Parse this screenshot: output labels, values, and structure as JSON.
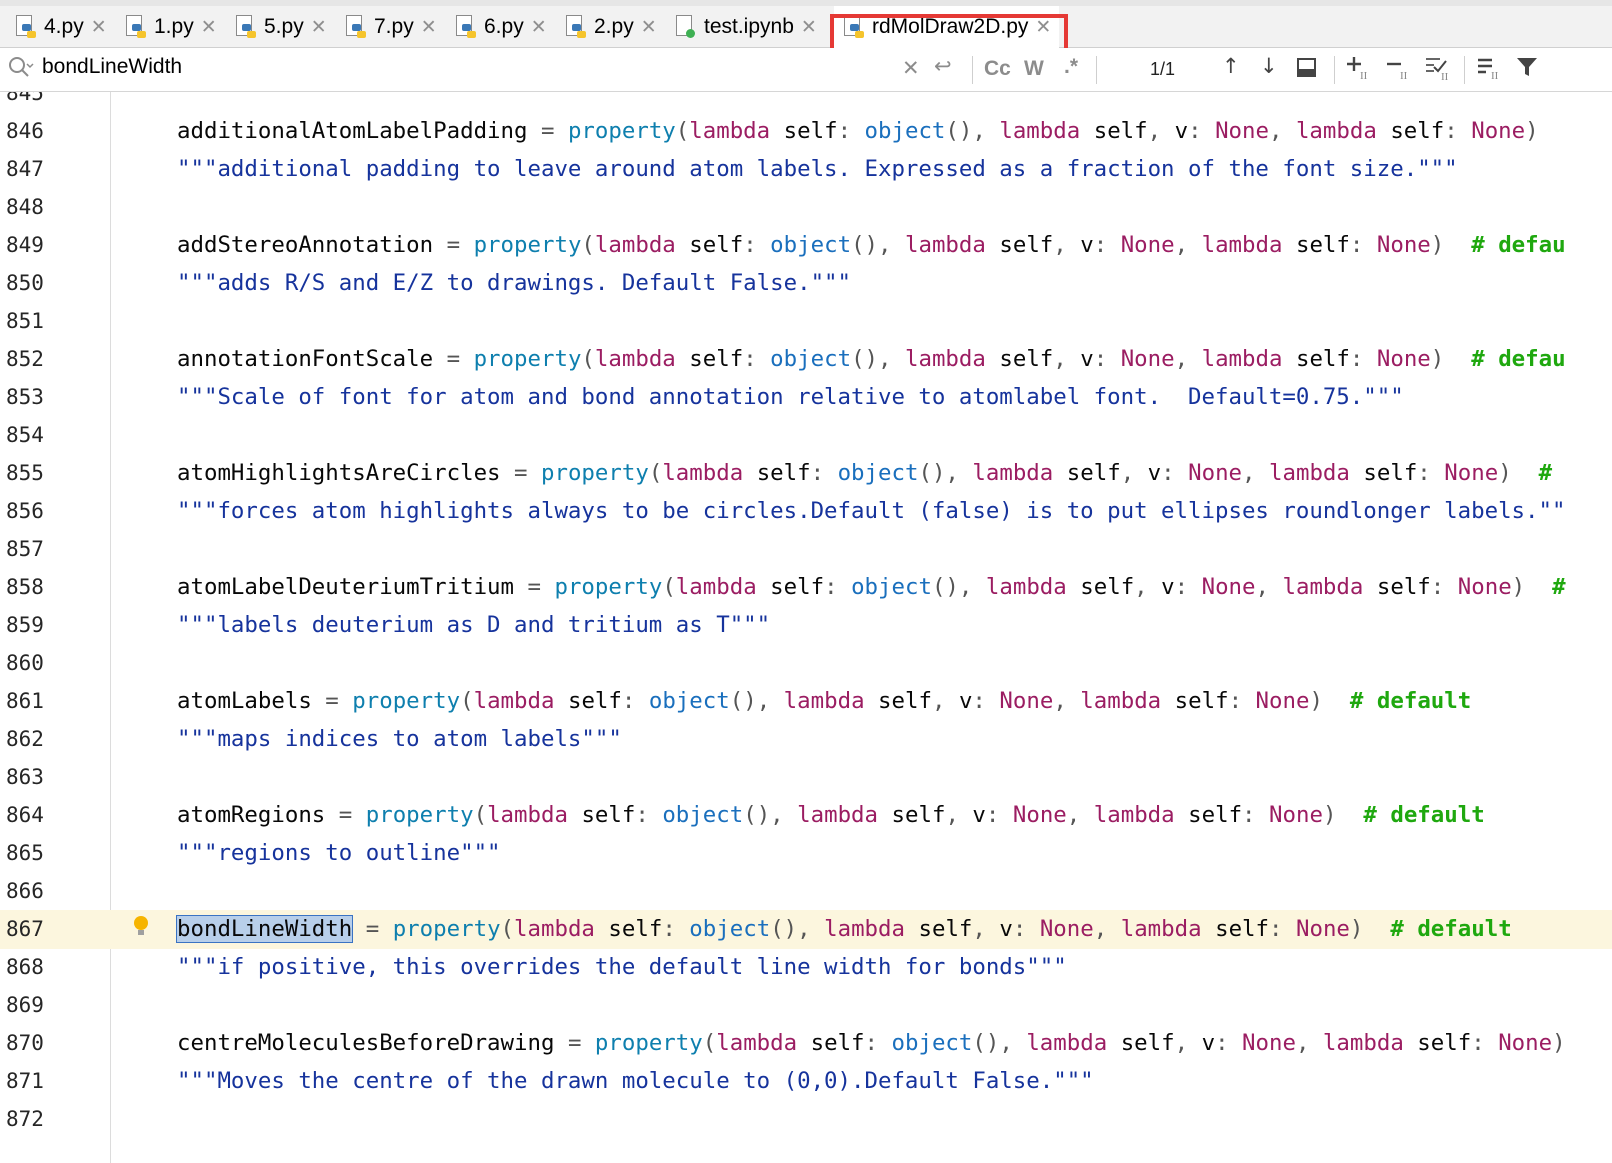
{
  "tabs": [
    {
      "label": "4.py",
      "kind": "py"
    },
    {
      "label": "1.py",
      "kind": "py"
    },
    {
      "label": "5.py",
      "kind": "py"
    },
    {
      "label": "7.py",
      "kind": "py"
    },
    {
      "label": "6.py",
      "kind": "py"
    },
    {
      "label": "2.py",
      "kind": "py"
    },
    {
      "label": "test.ipynb",
      "kind": "ipynb"
    },
    {
      "label": "rdMolDraw2D.py",
      "kind": "py",
      "active": true
    }
  ],
  "search": {
    "value": "bondLineWidth",
    "match_count": "1/1",
    "case_label": "Cc",
    "words_label": "W",
    "regex_label": ".*"
  },
  "editor": {
    "partial_line_number": "845",
    "current_line": "867",
    "lines": [
      {
        "n": "846",
        "code": [
          [
            "additionalAtomLabelPadding ",
            ""
          ],
          [
            "= ",
            "punc"
          ],
          [
            "property",
            "fn"
          ],
          [
            "(",
            "punc"
          ],
          [
            "lambda ",
            "kw"
          ],
          [
            "self",
            ""
          ],
          [
            ": ",
            "punc"
          ],
          [
            "object",
            "obj"
          ],
          [
            "(), ",
            "punc"
          ],
          [
            "lambda ",
            "kw"
          ],
          [
            "self",
            ""
          ],
          [
            ", ",
            "punc"
          ],
          [
            "v",
            ""
          ],
          [
            ": ",
            "punc"
          ],
          [
            "None",
            "none"
          ],
          [
            ", ",
            "punc"
          ],
          [
            "lambda ",
            "kw"
          ],
          [
            "self",
            ""
          ],
          [
            ": ",
            "punc"
          ],
          [
            "None",
            "none"
          ],
          [
            ")",
            "punc"
          ]
        ]
      },
      {
        "n": "847",
        "code": [
          [
            "\"\"\"additional padding to leave around atom labels. Expressed as a fraction of the font size.\"\"\"",
            "str"
          ]
        ]
      },
      {
        "n": "848",
        "code": []
      },
      {
        "n": "849",
        "code": [
          [
            "addStereoAnnotation ",
            ""
          ],
          [
            "= ",
            "punc"
          ],
          [
            "property",
            "fn"
          ],
          [
            "(",
            "punc"
          ],
          [
            "lambda ",
            "kw"
          ],
          [
            "self",
            ""
          ],
          [
            ": ",
            "punc"
          ],
          [
            "object",
            "obj"
          ],
          [
            "(), ",
            "punc"
          ],
          [
            "lambda ",
            "kw"
          ],
          [
            "self",
            ""
          ],
          [
            ", ",
            "punc"
          ],
          [
            "v",
            ""
          ],
          [
            ": ",
            "punc"
          ],
          [
            "None",
            "none"
          ],
          [
            ", ",
            "punc"
          ],
          [
            "lambda ",
            "kw"
          ],
          [
            "self",
            ""
          ],
          [
            ": ",
            "punc"
          ],
          [
            "None",
            "none"
          ],
          [
            ")  ",
            "punc"
          ],
          [
            "# defau",
            "cmt"
          ]
        ]
      },
      {
        "n": "850",
        "code": [
          [
            "\"\"\"adds R/S and E/Z to drawings. Default False.\"\"\"",
            "str"
          ]
        ]
      },
      {
        "n": "851",
        "code": []
      },
      {
        "n": "852",
        "code": [
          [
            "annotationFontScale ",
            ""
          ],
          [
            "= ",
            "punc"
          ],
          [
            "property",
            "fn"
          ],
          [
            "(",
            "punc"
          ],
          [
            "lambda ",
            "kw"
          ],
          [
            "self",
            ""
          ],
          [
            ": ",
            "punc"
          ],
          [
            "object",
            "obj"
          ],
          [
            "(), ",
            "punc"
          ],
          [
            "lambda ",
            "kw"
          ],
          [
            "self",
            ""
          ],
          [
            ", ",
            "punc"
          ],
          [
            "v",
            ""
          ],
          [
            ": ",
            "punc"
          ],
          [
            "None",
            "none"
          ],
          [
            ", ",
            "punc"
          ],
          [
            "lambda ",
            "kw"
          ],
          [
            "self",
            ""
          ],
          [
            ": ",
            "punc"
          ],
          [
            "None",
            "none"
          ],
          [
            ")  ",
            "punc"
          ],
          [
            "# defau",
            "cmt"
          ]
        ]
      },
      {
        "n": "853",
        "code": [
          [
            "\"\"\"Scale of font for atom and bond annotation relative to atomlabel font.  Default=0.75.\"\"\"",
            "str"
          ]
        ]
      },
      {
        "n": "854",
        "code": []
      },
      {
        "n": "855",
        "code": [
          [
            "atomHighlightsAreCircles ",
            ""
          ],
          [
            "= ",
            "punc"
          ],
          [
            "property",
            "fn"
          ],
          [
            "(",
            "punc"
          ],
          [
            "lambda ",
            "kw"
          ],
          [
            "self",
            ""
          ],
          [
            ": ",
            "punc"
          ],
          [
            "object",
            "obj"
          ],
          [
            "(), ",
            "punc"
          ],
          [
            "lambda ",
            "kw"
          ],
          [
            "self",
            ""
          ],
          [
            ", ",
            "punc"
          ],
          [
            "v",
            ""
          ],
          [
            ": ",
            "punc"
          ],
          [
            "None",
            "none"
          ],
          [
            ", ",
            "punc"
          ],
          [
            "lambda ",
            "kw"
          ],
          [
            "self",
            ""
          ],
          [
            ": ",
            "punc"
          ],
          [
            "None",
            "none"
          ],
          [
            ")  ",
            "punc"
          ],
          [
            "#",
            "cmt"
          ]
        ]
      },
      {
        "n": "856",
        "code": [
          [
            "\"\"\"forces atom highlights always to be circles.Default (false) is to put ellipses roundlonger labels.\"\"",
            "str"
          ]
        ]
      },
      {
        "n": "857",
        "code": []
      },
      {
        "n": "858",
        "code": [
          [
            "atomLabelDeuteriumTritium ",
            ""
          ],
          [
            "= ",
            "punc"
          ],
          [
            "property",
            "fn"
          ],
          [
            "(",
            "punc"
          ],
          [
            "lambda ",
            "kw"
          ],
          [
            "self",
            ""
          ],
          [
            ": ",
            "punc"
          ],
          [
            "object",
            "obj"
          ],
          [
            "(), ",
            "punc"
          ],
          [
            "lambda ",
            "kw"
          ],
          [
            "self",
            ""
          ],
          [
            ", ",
            "punc"
          ],
          [
            "v",
            ""
          ],
          [
            ": ",
            "punc"
          ],
          [
            "None",
            "none"
          ],
          [
            ", ",
            "punc"
          ],
          [
            "lambda ",
            "kw"
          ],
          [
            "self",
            ""
          ],
          [
            ": ",
            "punc"
          ],
          [
            "None",
            "none"
          ],
          [
            ")  ",
            "punc"
          ],
          [
            "#",
            "cmt"
          ]
        ]
      },
      {
        "n": "859",
        "code": [
          [
            "\"\"\"labels deuterium as D and tritium as T\"\"\"",
            "str"
          ]
        ]
      },
      {
        "n": "860",
        "code": []
      },
      {
        "n": "861",
        "code": [
          [
            "atomLabels ",
            ""
          ],
          [
            "= ",
            "punc"
          ],
          [
            "property",
            "fn"
          ],
          [
            "(",
            "punc"
          ],
          [
            "lambda ",
            "kw"
          ],
          [
            "self",
            ""
          ],
          [
            ": ",
            "punc"
          ],
          [
            "object",
            "obj"
          ],
          [
            "(), ",
            "punc"
          ],
          [
            "lambda ",
            "kw"
          ],
          [
            "self",
            ""
          ],
          [
            ", ",
            "punc"
          ],
          [
            "v",
            ""
          ],
          [
            ": ",
            "punc"
          ],
          [
            "None",
            "none"
          ],
          [
            ", ",
            "punc"
          ],
          [
            "lambda ",
            "kw"
          ],
          [
            "self",
            ""
          ],
          [
            ": ",
            "punc"
          ],
          [
            "None",
            "none"
          ],
          [
            ")  ",
            "punc"
          ],
          [
            "# default",
            "cmt"
          ]
        ]
      },
      {
        "n": "862",
        "code": [
          [
            "\"\"\"maps indices to atom labels\"\"\"",
            "str"
          ]
        ]
      },
      {
        "n": "863",
        "code": []
      },
      {
        "n": "864",
        "code": [
          [
            "atomRegions ",
            ""
          ],
          [
            "= ",
            "punc"
          ],
          [
            "property",
            "fn"
          ],
          [
            "(",
            "punc"
          ],
          [
            "lambda ",
            "kw"
          ],
          [
            "self",
            ""
          ],
          [
            ": ",
            "punc"
          ],
          [
            "object",
            "obj"
          ],
          [
            "(), ",
            "punc"
          ],
          [
            "lambda ",
            "kw"
          ],
          [
            "self",
            ""
          ],
          [
            ", ",
            "punc"
          ],
          [
            "v",
            ""
          ],
          [
            ": ",
            "punc"
          ],
          [
            "None",
            "none"
          ],
          [
            ", ",
            "punc"
          ],
          [
            "lambda ",
            "kw"
          ],
          [
            "self",
            ""
          ],
          [
            ": ",
            "punc"
          ],
          [
            "None",
            "none"
          ],
          [
            ")  ",
            "punc"
          ],
          [
            "# default",
            "cmt"
          ]
        ]
      },
      {
        "n": "865",
        "code": [
          [
            "\"\"\"regions to outline\"\"\"",
            "str"
          ]
        ]
      },
      {
        "n": "866",
        "code": []
      },
      {
        "n": "867",
        "code": [
          [
            "bondLineWidth",
            "match"
          ],
          [
            " ",
            ""
          ],
          [
            "= ",
            "punc"
          ],
          [
            "property",
            "fn"
          ],
          [
            "(",
            "punc"
          ],
          [
            "lambda ",
            "kw"
          ],
          [
            "self",
            ""
          ],
          [
            ": ",
            "punc"
          ],
          [
            "object",
            "obj"
          ],
          [
            "(), ",
            "punc"
          ],
          [
            "lambda ",
            "kw"
          ],
          [
            "self",
            ""
          ],
          [
            ", ",
            "punc"
          ],
          [
            "v",
            ""
          ],
          [
            ": ",
            "punc"
          ],
          [
            "None",
            "none"
          ],
          [
            ", ",
            "punc"
          ],
          [
            "lambda ",
            "kw"
          ],
          [
            "self",
            ""
          ],
          [
            ": ",
            "punc"
          ],
          [
            "None",
            "none"
          ],
          [
            ")  ",
            "punc"
          ],
          [
            "# default",
            "cmt"
          ]
        ]
      },
      {
        "n": "868",
        "code": [
          [
            "\"\"\"if positive, this overrides the default line width for bonds\"\"\"",
            "str"
          ]
        ]
      },
      {
        "n": "869",
        "code": []
      },
      {
        "n": "870",
        "code": [
          [
            "centreMoleculesBeforeDrawing ",
            ""
          ],
          [
            "= ",
            "punc"
          ],
          [
            "property",
            "fn"
          ],
          [
            "(",
            "punc"
          ],
          [
            "lambda ",
            "kw"
          ],
          [
            "self",
            ""
          ],
          [
            ": ",
            "punc"
          ],
          [
            "object",
            "obj"
          ],
          [
            "(), ",
            "punc"
          ],
          [
            "lambda ",
            "kw"
          ],
          [
            "self",
            ""
          ],
          [
            ", ",
            "punc"
          ],
          [
            "v",
            ""
          ],
          [
            ": ",
            "punc"
          ],
          [
            "None",
            "none"
          ],
          [
            ", ",
            "punc"
          ],
          [
            "lambda ",
            "kw"
          ],
          [
            "self",
            ""
          ],
          [
            ": ",
            "punc"
          ],
          [
            "None",
            "none"
          ],
          [
            ")",
            "punc"
          ]
        ]
      },
      {
        "n": "871",
        "code": [
          [
            "\"\"\"Moves the centre of the drawn molecule to (0,0).Default False.\"\"\"",
            "str"
          ]
        ]
      },
      {
        "n": "872",
        "code": []
      }
    ]
  },
  "colors": {
    "highlight_border": "#e53935",
    "current_line_bg": "#fcf6de",
    "match_bg": "#b8cfea",
    "string": "#16339c",
    "keyword": "#9b1d62",
    "builtin": "#0e7fae",
    "comment": "#1fa80f"
  },
  "icons": {
    "tab_file": "python-file-icon",
    "notebook_file": "jupyter-file-icon",
    "tab_close": "close-icon",
    "search": "search-icon",
    "clear": "clear-icon",
    "newline": "newline-icon",
    "prev": "arrow-up-icon",
    "next": "arrow-down-icon",
    "filter": "filter-icon",
    "bulb": "lightbulb-icon"
  }
}
